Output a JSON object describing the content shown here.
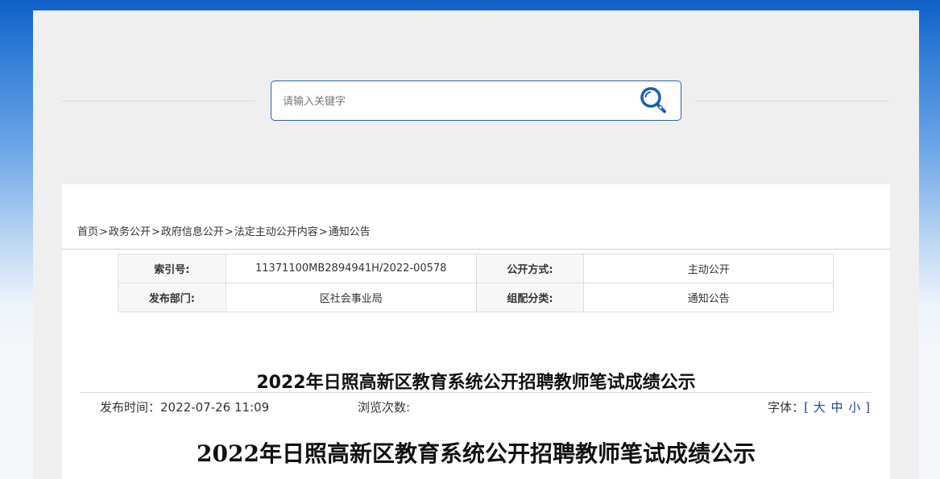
{
  "search": {
    "placeholder": "请输入关键字"
  },
  "breadcrumb": {
    "items": [
      "首页",
      "政务公开",
      "政府信息公开",
      "法定主动公开内容",
      "通知公告"
    ],
    "separator": ">"
  },
  "meta": {
    "index_label": "索引号:",
    "index_value": "11371100MB2894941H/2022-00578",
    "open_mode_label": "公开方式:",
    "open_mode_value": "主动公开",
    "dept_label": "发布部门:",
    "dept_value": "区社会事业局",
    "category_label": "组配分类:",
    "category_value": "通知公告"
  },
  "article": {
    "title": "2022年日照高新区教育系统公开招聘教师笔试成绩公示",
    "publish_label": "发布时间：",
    "publish_time": "2022-07-26 11:09",
    "views_label": "浏览次数:",
    "font_label": "字体：",
    "font_open": "[",
    "font_large": "大",
    "font_medium": "中",
    "font_small": "小",
    "font_close": "]",
    "doc_title": "2022年日照高新区教育系统公开招聘教师笔试成绩公示"
  },
  "colors": {
    "accent_blue": "#2a62b5",
    "link_blue": "#1d3fa6"
  }
}
